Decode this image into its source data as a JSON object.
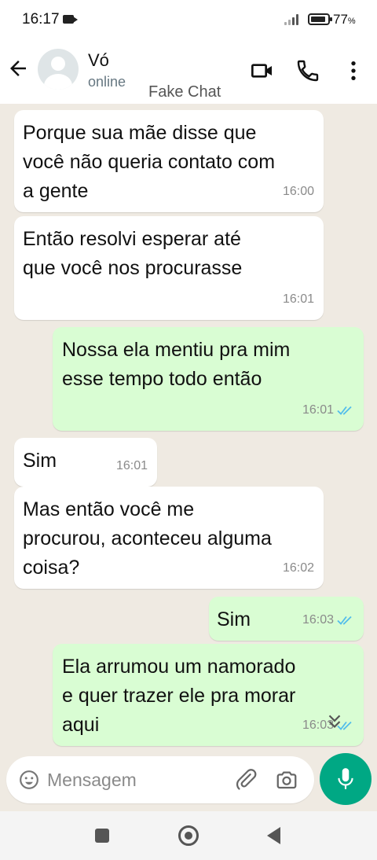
{
  "status_bar": {
    "time": "16:17",
    "battery_value": "77",
    "battery_unit": "%"
  },
  "header": {
    "contact_name": "Vó",
    "contact_status": "online",
    "watermark": "Fake Chat"
  },
  "messages": [
    {
      "direction": "in",
      "text": "Porque sua mãe disse que\nvocê não queria contato com\na gente",
      "time": "16:00"
    },
    {
      "direction": "in",
      "text": "Então resolvi esperar até\nque você nos procurasse",
      "time": "16:01"
    },
    {
      "direction": "out",
      "text": "Nossa ela mentiu pra mim\nesse tempo todo então",
      "time": "16:01",
      "status": "read"
    },
    {
      "direction": "in",
      "text": "Sim",
      "time": "16:01"
    },
    {
      "direction": "in",
      "text": "Mas então você me\nprocurou, aconteceu alguma\ncoisa?",
      "time": "16:02"
    },
    {
      "direction": "out",
      "text": "Sim",
      "time": "16:03",
      "status": "read"
    },
    {
      "direction": "out",
      "text": "Ela arrumou um namorado\ne quer trazer ele pra morar\naqui",
      "time": "16:03",
      "status": "read"
    }
  ],
  "composer": {
    "placeholder": "Mensagem"
  },
  "colors": {
    "header_bg": "#ffffff",
    "chat_bg": "#efeae2",
    "incoming_bubble": "#ffffff",
    "outgoing_bubble": "#d9fdd3",
    "accent": "#00a884",
    "read_ticks": "#53bdeb"
  },
  "icons": [
    "back-arrow-icon",
    "avatar-placeholder",
    "video-call-icon",
    "phone-icon",
    "more-vert-icon",
    "emoji-icon",
    "attach-icon",
    "camera-icon",
    "mic-icon",
    "scroll-down-icon",
    "double-check-icon"
  ]
}
